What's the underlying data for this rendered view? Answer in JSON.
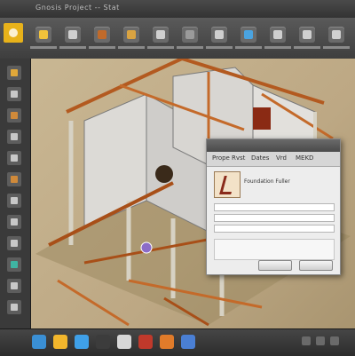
{
  "window": {
    "title": "Gnosis  Project  --  Stat  "
  },
  "ribbon": {
    "buttons": [
      {
        "icon": "home-icon",
        "color": "#f0c23b"
      },
      {
        "icon": "camera-icon",
        "color": "#cfcfcf"
      },
      {
        "icon": "tools-icon",
        "color": "#c06a2a"
      },
      {
        "icon": "folder-icon",
        "color": "#d9a341"
      },
      {
        "icon": "window-icon",
        "color": "#cfcfcf"
      },
      {
        "icon": "frame-icon",
        "color": "#9a9a9a"
      },
      {
        "icon": "grid-icon",
        "color": "#cfcfcf"
      },
      {
        "icon": "render-icon",
        "color": "#4aa3e0"
      },
      {
        "icon": "layers-icon",
        "color": "#cfcfcf"
      },
      {
        "icon": "settings-icon",
        "color": "#cfcfcf"
      },
      {
        "icon": "export-icon",
        "color": "#cfcfcf"
      }
    ]
  },
  "sidebar": {
    "icons": [
      {
        "icon": "select-icon",
        "color": "#e0a83a"
      },
      {
        "icon": "move-icon",
        "color": "#c8c8c8"
      },
      {
        "icon": "rotate-icon",
        "color": "#d08a3a"
      },
      {
        "icon": "scale-icon",
        "color": "#c8c8c8"
      },
      {
        "icon": "wall-icon",
        "color": "#c8c8c8"
      },
      {
        "icon": "beam-icon",
        "color": "#d08a3a"
      },
      {
        "icon": "column-icon",
        "color": "#c8c8c8"
      },
      {
        "icon": "measure-icon",
        "color": "#c8c8c8"
      },
      {
        "icon": "section-icon",
        "color": "#c8c8c8"
      },
      {
        "icon": "material-icon",
        "color": "#3fb5a3"
      },
      {
        "icon": "light-icon",
        "color": "#c8c8c8"
      },
      {
        "icon": "camera-view-icon",
        "color": "#c8c8c8"
      }
    ]
  },
  "dialog": {
    "tabs": [
      "Prope",
      "Rvst",
      "Dates",
      "Vrd",
      "MEKD"
    ],
    "item_name": "Foundation Fuller",
    "ok_label": "",
    "cancel_label": ""
  },
  "taskbar": {
    "icons": [
      {
        "icon": "start-icon",
        "color": "#3a8fd4"
      },
      {
        "icon": "explorer-icon",
        "color": "#f2b62c"
      },
      {
        "icon": "browser-icon",
        "color": "#3fa0e8"
      },
      {
        "icon": "media-icon",
        "color": "#3c3c3c"
      },
      {
        "icon": "cad-icon",
        "color": "#d8d8d8"
      },
      {
        "icon": "pdf-icon",
        "color": "#c0392b"
      },
      {
        "icon": "image-icon",
        "color": "#e07b2a"
      },
      {
        "icon": "chat-icon",
        "color": "#4a7fd4"
      }
    ]
  }
}
